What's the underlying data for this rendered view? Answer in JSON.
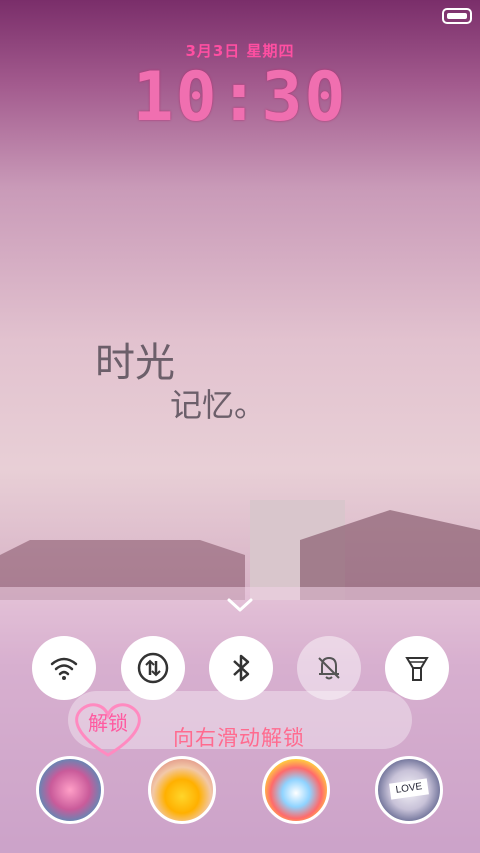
{
  "status_bar": {
    "battery_icon": "battery-icon"
  },
  "lockscreen": {
    "date": "3月3日 星期四",
    "time": "10:30",
    "wallpaper_text_line1": "时光",
    "wallpaper_text_line2": "记忆。"
  },
  "quick_panel": {
    "expand_icon": "chevron-down-icon",
    "toggles": [
      {
        "name": "wifi",
        "icon": "wifi-icon",
        "state": "on"
      },
      {
        "name": "data",
        "icon": "data-transfer-icon",
        "state": "on"
      },
      {
        "name": "bluetooth",
        "icon": "bluetooth-icon",
        "state": "on"
      },
      {
        "name": "silent",
        "icon": "bell-off-icon",
        "state": "off"
      },
      {
        "name": "flashlight",
        "icon": "flashlight-icon",
        "state": "on"
      }
    ]
  },
  "unlock": {
    "heart_label": "解锁",
    "instruction": "向右滑动解锁"
  },
  "shortcuts": [
    {
      "name": "roses",
      "icon": "roses-shortcut-icon"
    },
    {
      "name": "nail-polish",
      "icon": "nail-polish-shortcut-icon"
    },
    {
      "name": "candy",
      "icon": "candy-shortcut-icon"
    },
    {
      "name": "love",
      "icon": "love-card-shortcut-icon",
      "label": "LOVE"
    }
  ],
  "colors": {
    "accent_pink": "#ff4fa2",
    "time_pink": "#f06fb0",
    "unlock_text": "#ff6b8f"
  }
}
